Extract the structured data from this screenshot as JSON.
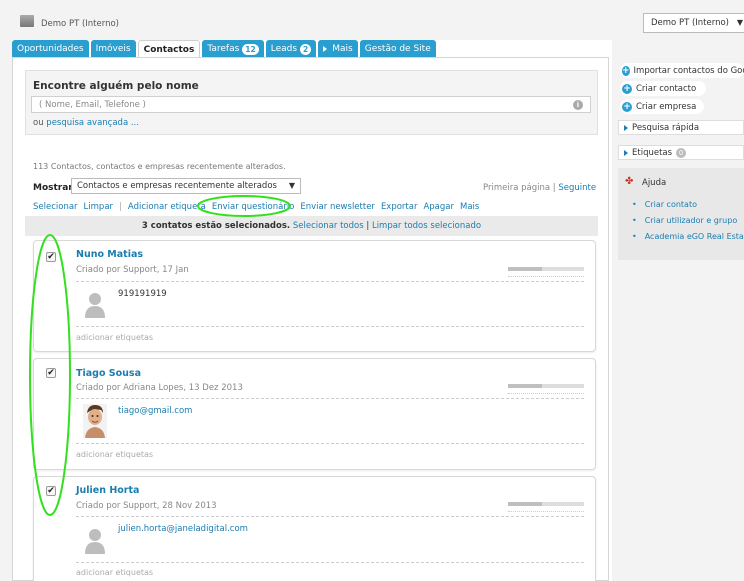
{
  "header": {
    "app_title": "Demo PT (Interno)",
    "account_label": "Demo PT (Interno)"
  },
  "tabs": [
    {
      "label": "Oportunidades",
      "badge": ""
    },
    {
      "label": "Imóveis",
      "badge": ""
    },
    {
      "label": "Contactos",
      "badge": "",
      "active": true
    },
    {
      "label": "Tarefas",
      "badge": "12"
    },
    {
      "label": "Leads",
      "badge": "2"
    },
    {
      "label": "Mais",
      "badge": ""
    },
    {
      "label": "Gestão de Site",
      "badge": ""
    }
  ],
  "search": {
    "heading": "Encontre alguém pelo nome",
    "placeholder": "( Nome, Email, Telefone )",
    "advanced_prefix": "ou",
    "advanced_link": "pesquisa avançada ..."
  },
  "list": {
    "summary": "113 Contactos, contactos e empresas recentemente alterados.",
    "show_label": "Mostrar",
    "show_value": "Contactos e empresas recentemente alterados",
    "pager_first": "Primeira página",
    "pager_sep": "|",
    "pager_next": "Seguinte"
  },
  "actions": {
    "select": "Selecionar",
    "clear": "Limpar",
    "sep": "|",
    "add_tag": "Adicionar etiqueta",
    "send_survey": "Enviar questionário",
    "send_newsletter": "Enviar newsletter",
    "export": "Exportar",
    "delete": "Apagar",
    "more": "Mais"
  },
  "selection": {
    "count_text": "3 contatos estão selecionados.",
    "select_all": "Selecionar todos",
    "sep": "|",
    "clear_all": "Limpar todos selecionado"
  },
  "contacts": [
    {
      "name": "Nuno Matias",
      "meta": "Criado por Support, 17 Jan",
      "contact": "919191919",
      "contact_is_link": false,
      "tags_link": "adicionar etiquetas",
      "checked": true,
      "has_photo": false
    },
    {
      "name": "Tiago Sousa",
      "meta": "Criado por Adriana Lopes, 13 Dez 2013",
      "contact": "tiago@gmail.com",
      "contact_is_link": true,
      "tags_link": "adicionar etiquetas",
      "checked": true,
      "has_photo": true
    },
    {
      "name": "Julien Horta",
      "meta": "Criado por Support, 28 Nov 2013",
      "contact": "julien.horta@janeladigital.com",
      "contact_is_link": true,
      "tags_link": "adicionar etiquetas",
      "checked": true,
      "has_photo": false
    }
  ],
  "sidebar": {
    "import_label": "Importar contactos do Google",
    "create_contact": "Criar contacto",
    "create_company": "Criar empresa",
    "quick_search": "Pesquisa rápida",
    "tags": "Etiquetas",
    "tags_count": "0",
    "help_title": "Ajuda",
    "help_links": [
      "Criar contato",
      "Criar utilizador e grupo",
      "Academia eGO Real Estate"
    ]
  },
  "colors": {
    "accent": "#2a9ecf",
    "link": "#1a7db0",
    "annotation": "#33e01f"
  }
}
